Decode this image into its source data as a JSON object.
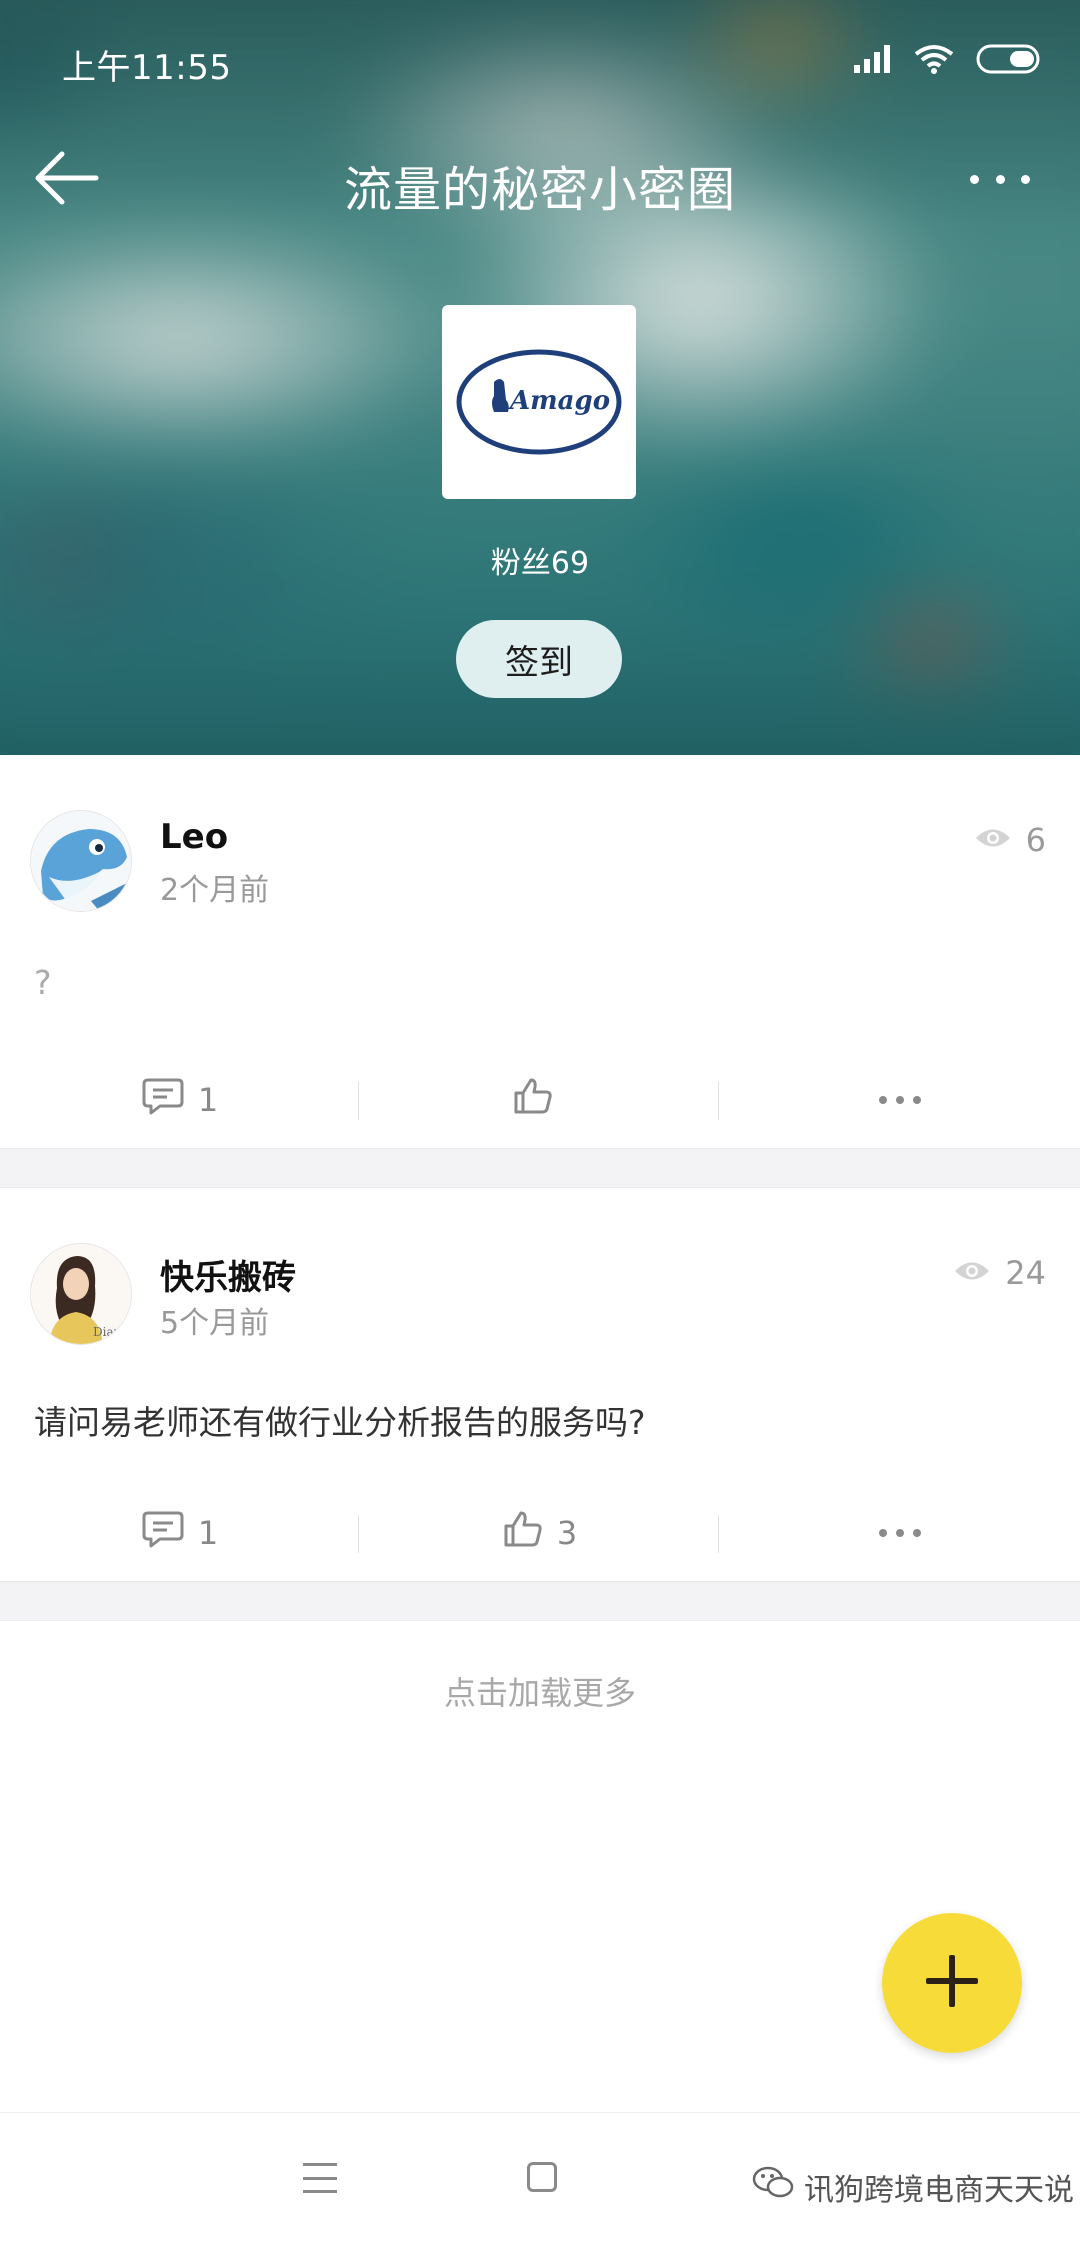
{
  "status_bar": {
    "time": "上午11:55"
  },
  "header": {
    "title": "流量的秘密小密圈",
    "logo_text": "Amago",
    "fans": "粉丝69",
    "checkin_label": "签到"
  },
  "posts": [
    {
      "author": "Leo",
      "time": "2个月前",
      "views": "6",
      "content": "?",
      "comments": "1",
      "likes": ""
    },
    {
      "author": "快乐搬砖",
      "time": "5个月前",
      "views": "24",
      "content": "请问易老师还有做行业分析报告的服务吗?",
      "comments": "1",
      "likes": "3"
    }
  ],
  "load_more": "点击加载更多",
  "watermark": "讯狗跨境电商天天说",
  "colors": {
    "fab": "#f7dc39",
    "checkin_bg": "#dfeeee",
    "logo_ring": "#1f3f7a"
  },
  "icons": [
    "back-arrow-icon",
    "more-icon",
    "signal-icon",
    "wifi-icon",
    "battery-icon",
    "eye-icon",
    "comment-icon",
    "thumbs-up-icon",
    "plus-icon",
    "menu-icon",
    "home-icon",
    "wechat-icon"
  ]
}
